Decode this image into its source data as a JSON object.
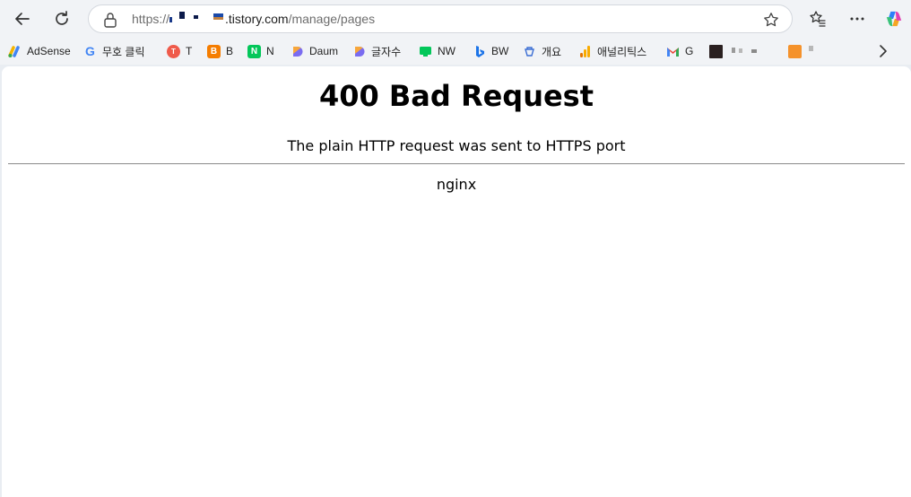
{
  "toolbar": {
    "url": {
      "scheme": "https://",
      "domain": ".tistory.com",
      "path": "/manage/pages"
    }
  },
  "bookmarks": [
    {
      "label": "AdSense",
      "icon": "adsense-icon"
    },
    {
      "label": "무호 클릭",
      "icon": "google-icon"
    },
    {
      "label": "T",
      "icon": "tistory-icon"
    },
    {
      "label": "B",
      "icon": "blogger-icon"
    },
    {
      "label": "N",
      "icon": "naver-icon"
    },
    {
      "label": "Daum",
      "icon": "daum-icon"
    },
    {
      "label": "글자수",
      "icon": "daum-icon"
    },
    {
      "label": "NW",
      "icon": "naver-webmaster-icon"
    },
    {
      "label": "BW",
      "icon": "bing-icon"
    },
    {
      "label": "개요",
      "icon": "overview-icon"
    },
    {
      "label": "애널리틱스",
      "icon": "analytics-icon"
    },
    {
      "label": "G",
      "icon": "gmail-icon"
    }
  ],
  "page": {
    "title": "400 Bad Request",
    "message": "The plain HTTP request was sent to HTTPS port",
    "server": "nginx"
  },
  "colors": {
    "toolbar_bg": "#f1f3f6",
    "content_bg": "#ffffff",
    "divider": "#8a8a8a"
  }
}
